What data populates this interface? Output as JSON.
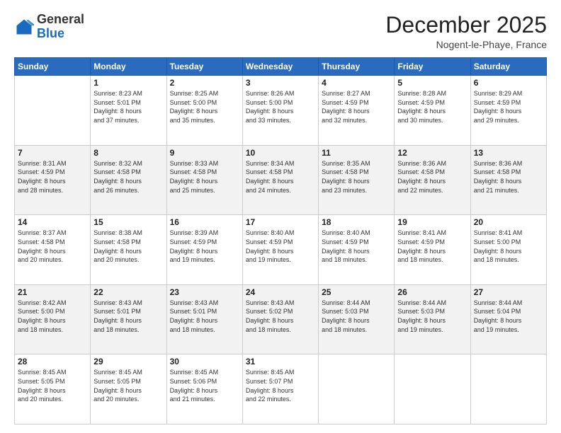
{
  "header": {
    "logo_general": "General",
    "logo_blue": "Blue",
    "month_title": "December 2025",
    "location": "Nogent-le-Phaye, France"
  },
  "days_of_week": [
    "Sunday",
    "Monday",
    "Tuesday",
    "Wednesday",
    "Thursday",
    "Friday",
    "Saturday"
  ],
  "weeks": [
    [
      {
        "day": "",
        "info": ""
      },
      {
        "day": "1",
        "info": "Sunrise: 8:23 AM\nSunset: 5:01 PM\nDaylight: 8 hours\nand 37 minutes."
      },
      {
        "day": "2",
        "info": "Sunrise: 8:25 AM\nSunset: 5:00 PM\nDaylight: 8 hours\nand 35 minutes."
      },
      {
        "day": "3",
        "info": "Sunrise: 8:26 AM\nSunset: 5:00 PM\nDaylight: 8 hours\nand 33 minutes."
      },
      {
        "day": "4",
        "info": "Sunrise: 8:27 AM\nSunset: 4:59 PM\nDaylight: 8 hours\nand 32 minutes."
      },
      {
        "day": "5",
        "info": "Sunrise: 8:28 AM\nSunset: 4:59 PM\nDaylight: 8 hours\nand 30 minutes."
      },
      {
        "day": "6",
        "info": "Sunrise: 8:29 AM\nSunset: 4:59 PM\nDaylight: 8 hours\nand 29 minutes."
      }
    ],
    [
      {
        "day": "7",
        "info": "Sunrise: 8:31 AM\nSunset: 4:59 PM\nDaylight: 8 hours\nand 28 minutes."
      },
      {
        "day": "8",
        "info": "Sunrise: 8:32 AM\nSunset: 4:58 PM\nDaylight: 8 hours\nand 26 minutes."
      },
      {
        "day": "9",
        "info": "Sunrise: 8:33 AM\nSunset: 4:58 PM\nDaylight: 8 hours\nand 25 minutes."
      },
      {
        "day": "10",
        "info": "Sunrise: 8:34 AM\nSunset: 4:58 PM\nDaylight: 8 hours\nand 24 minutes."
      },
      {
        "day": "11",
        "info": "Sunrise: 8:35 AM\nSunset: 4:58 PM\nDaylight: 8 hours\nand 23 minutes."
      },
      {
        "day": "12",
        "info": "Sunrise: 8:36 AM\nSunset: 4:58 PM\nDaylight: 8 hours\nand 22 minutes."
      },
      {
        "day": "13",
        "info": "Sunrise: 8:36 AM\nSunset: 4:58 PM\nDaylight: 8 hours\nand 21 minutes."
      }
    ],
    [
      {
        "day": "14",
        "info": "Sunrise: 8:37 AM\nSunset: 4:58 PM\nDaylight: 8 hours\nand 20 minutes."
      },
      {
        "day": "15",
        "info": "Sunrise: 8:38 AM\nSunset: 4:58 PM\nDaylight: 8 hours\nand 20 minutes."
      },
      {
        "day": "16",
        "info": "Sunrise: 8:39 AM\nSunset: 4:59 PM\nDaylight: 8 hours\nand 19 minutes."
      },
      {
        "day": "17",
        "info": "Sunrise: 8:40 AM\nSunset: 4:59 PM\nDaylight: 8 hours\nand 19 minutes."
      },
      {
        "day": "18",
        "info": "Sunrise: 8:40 AM\nSunset: 4:59 PM\nDaylight: 8 hours\nand 18 minutes."
      },
      {
        "day": "19",
        "info": "Sunrise: 8:41 AM\nSunset: 4:59 PM\nDaylight: 8 hours\nand 18 minutes."
      },
      {
        "day": "20",
        "info": "Sunrise: 8:41 AM\nSunset: 5:00 PM\nDaylight: 8 hours\nand 18 minutes."
      }
    ],
    [
      {
        "day": "21",
        "info": "Sunrise: 8:42 AM\nSunset: 5:00 PM\nDaylight: 8 hours\nand 18 minutes."
      },
      {
        "day": "22",
        "info": "Sunrise: 8:43 AM\nSunset: 5:01 PM\nDaylight: 8 hours\nand 18 minutes."
      },
      {
        "day": "23",
        "info": "Sunrise: 8:43 AM\nSunset: 5:01 PM\nDaylight: 8 hours\nand 18 minutes."
      },
      {
        "day": "24",
        "info": "Sunrise: 8:43 AM\nSunset: 5:02 PM\nDaylight: 8 hours\nand 18 minutes."
      },
      {
        "day": "25",
        "info": "Sunrise: 8:44 AM\nSunset: 5:03 PM\nDaylight: 8 hours\nand 18 minutes."
      },
      {
        "day": "26",
        "info": "Sunrise: 8:44 AM\nSunset: 5:03 PM\nDaylight: 8 hours\nand 19 minutes."
      },
      {
        "day": "27",
        "info": "Sunrise: 8:44 AM\nSunset: 5:04 PM\nDaylight: 8 hours\nand 19 minutes."
      }
    ],
    [
      {
        "day": "28",
        "info": "Sunrise: 8:45 AM\nSunset: 5:05 PM\nDaylight: 8 hours\nand 20 minutes."
      },
      {
        "day": "29",
        "info": "Sunrise: 8:45 AM\nSunset: 5:05 PM\nDaylight: 8 hours\nand 20 minutes."
      },
      {
        "day": "30",
        "info": "Sunrise: 8:45 AM\nSunset: 5:06 PM\nDaylight: 8 hours\nand 21 minutes."
      },
      {
        "day": "31",
        "info": "Sunrise: 8:45 AM\nSunset: 5:07 PM\nDaylight: 8 hours\nand 22 minutes."
      },
      {
        "day": "",
        "info": ""
      },
      {
        "day": "",
        "info": ""
      },
      {
        "day": "",
        "info": ""
      }
    ]
  ]
}
